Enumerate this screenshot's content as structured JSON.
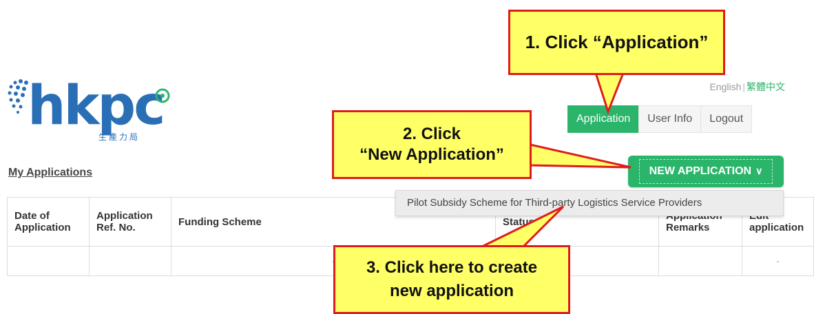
{
  "header": {
    "logo": {
      "word": "hkpc",
      "subtitle": "生產力局"
    },
    "language": {
      "english": "English",
      "separator": "|",
      "chinese": "繁體中文"
    },
    "nav": [
      {
        "label": "Application",
        "active": true
      },
      {
        "label": "User Info",
        "active": false
      },
      {
        "label": "Logout",
        "active": false
      }
    ]
  },
  "main": {
    "section_title": "My Applications",
    "new_application": {
      "label": "NEW APPLICATION",
      "chevron": "chevron-down-icon"
    },
    "dropdown_items": [
      "Pilot Subsidy Scheme for Third-party Logistics Service Providers"
    ],
    "table": {
      "columns": [
        "Date of Application",
        "Application Ref. No.",
        "Funding Scheme",
        "Status",
        "Application Remarks",
        "Edit application"
      ],
      "rows": [
        [
          "",
          "",
          "-",
          "",
          "",
          "-"
        ]
      ]
    }
  },
  "callouts": {
    "step1": "1. Click “Application”",
    "step2_line1": "2. Click",
    "step2_line2": "“New Application”",
    "step3_line1": "3. Click here to create",
    "step3_line2": "new application"
  },
  "colors": {
    "brand_green": "#2bb56b",
    "logo_blue": "#2a6fb6",
    "callout_fill": "#ffff66",
    "callout_border": "#e01b1b"
  }
}
